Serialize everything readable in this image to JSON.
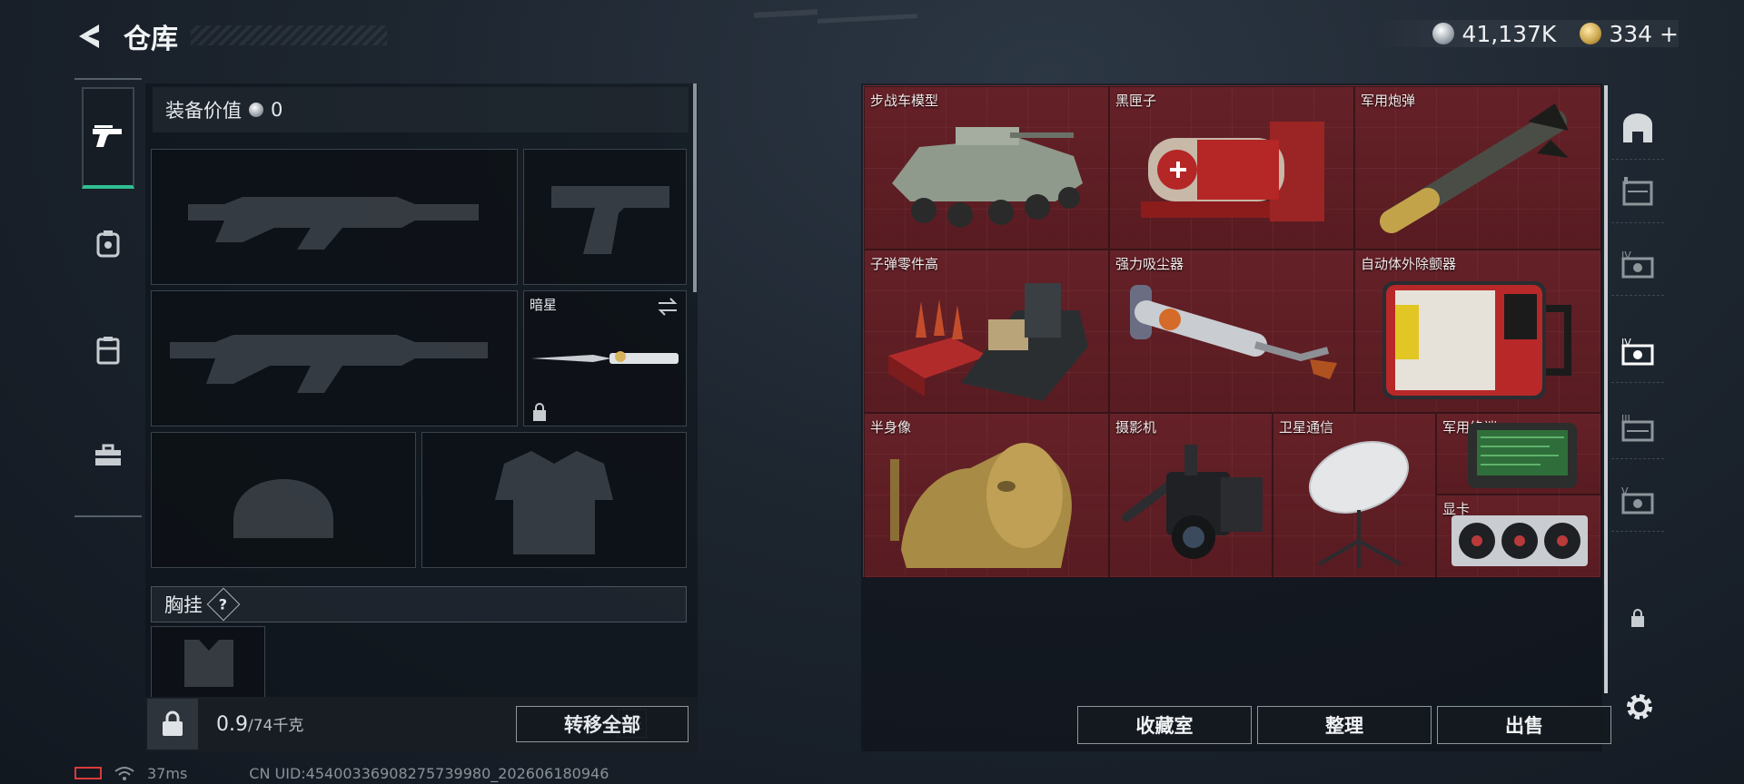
{
  "header": {
    "title": "仓库",
    "back_icon": "back-arrow-icon",
    "currencies": [
      {
        "icon": "silver-coin-icon",
        "value": "41,137K"
      },
      {
        "icon": "gold-coin-icon",
        "value": "334",
        "suffix": "+"
      }
    ]
  },
  "left_rail": {
    "items": [
      {
        "name": "weapons",
        "icon": "pistol-icon",
        "active": true
      },
      {
        "name": "armor",
        "icon": "backpack-icon",
        "active": false
      },
      {
        "name": "vest",
        "icon": "vest-icon",
        "active": false
      },
      {
        "name": "supplies",
        "icon": "toolbox-icon",
        "active": false
      }
    ]
  },
  "equipment": {
    "value_label": "装备价值",
    "value": "0",
    "melee_slot": {
      "label": "暗星",
      "locked": true
    },
    "chest_rig_label": "胸挂",
    "chest_rig_help": "?",
    "weight_current": "0.9",
    "weight_max": "/74千克",
    "transfer_all_label": "转移全部"
  },
  "stash": {
    "items": [
      {
        "label": "步战车模型",
        "icon": "ifv-model-icon"
      },
      {
        "label": "黑匣子",
        "icon": "black-box-icon"
      },
      {
        "label": "军用炮弹",
        "icon": "artillery-shell-icon"
      },
      {
        "label": "子弹零件高",
        "icon": "ammo-parts-icon"
      },
      {
        "label": "强力吸尘器",
        "icon": "vacuum-cleaner-icon"
      },
      {
        "label": "自动体外除颤器",
        "icon": "defibrillator-icon"
      },
      {
        "label": "半身像",
        "icon": "bust-statue-icon"
      },
      {
        "label": "摄影机",
        "icon": "video-camera-icon"
      },
      {
        "label": "卫星通信",
        "icon": "satellite-dish-icon"
      },
      {
        "label": "军用终端",
        "icon": "military-terminal-icon"
      },
      {
        "label": "显卡",
        "icon": "graphics-card-icon"
      }
    ]
  },
  "right_rail": {
    "items": [
      {
        "icon": "vault-door-icon"
      },
      {
        "icon": "stash-tier-1-icon"
      },
      {
        "icon": "stash-tier-4-icon"
      },
      {
        "icon": "stash-tier-4-active-icon"
      },
      {
        "icon": "stash-tier-3-icon"
      },
      {
        "icon": "stash-tier-5-icon"
      },
      {
        "icon": "locked-tab-icon"
      }
    ]
  },
  "actions": {
    "collection_label": "收藏室",
    "sort_label": "整理",
    "sell_label": "出售"
  },
  "status": {
    "ping": "37ms",
    "uid": "CN UID:4540033690827573998​0_202606180946"
  },
  "colors": {
    "accent": "#2fbf91",
    "stash_red": "#5b1d23",
    "battery_warning": "#d93a3a"
  }
}
